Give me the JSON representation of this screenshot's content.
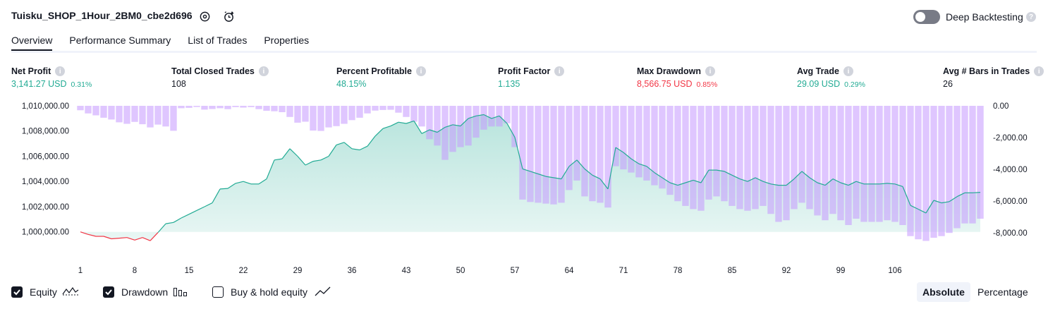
{
  "header": {
    "strategy_title": "Tuisku_SHOP_1Hour_2BM0_cbe2d696",
    "settings_icon": "gear-icon",
    "alert_icon": "alert-clock-icon",
    "deep_backtesting_label": "Deep Backtesting",
    "deep_backtesting_enabled": false
  },
  "tabs": [
    {
      "label": "Overview",
      "active": true
    },
    {
      "label": "Performance Summary",
      "active": false
    },
    {
      "label": "List of Trades",
      "active": false
    },
    {
      "label": "Properties",
      "active": false
    }
  ],
  "stats": [
    {
      "label": "Net Profit",
      "value": "3,141.27 USD",
      "pct": "0.31%",
      "tone": "green"
    },
    {
      "label": "Total Closed Trades",
      "value": "108",
      "pct": "",
      "tone": "dark"
    },
    {
      "label": "Percent Profitable",
      "value": "48.15%",
      "pct": "",
      "tone": "green"
    },
    {
      "label": "Profit Factor",
      "value": "1.135",
      "pct": "",
      "tone": "green"
    },
    {
      "label": "Max Drawdown",
      "value": "8,566.75 USD",
      "pct": "0.85%",
      "tone": "red"
    },
    {
      "label": "Avg Trade",
      "value": "29.09 USD",
      "pct": "0.29%",
      "tone": "green"
    },
    {
      "label": "Avg # Bars in Trades",
      "value": "26",
      "pct": "",
      "tone": "dark"
    }
  ],
  "chart_data": {
    "type": "area",
    "title": "",
    "x_ticks": [
      "1",
      "8",
      "15",
      "22",
      "29",
      "36",
      "43",
      "50",
      "57",
      "64",
      "71",
      "78",
      "85",
      "92",
      "99",
      "106"
    ],
    "left_axis": {
      "ticks": [
        "1,010,000.00",
        "1,008,000.00",
        "1,006,000.00",
        "1,004,000.00",
        "1,002,000.00",
        "1,000,000.00"
      ],
      "ylim": [
        999200,
        1010000
      ]
    },
    "right_axis": {
      "ticks": [
        "0.00",
        "-2,000.00",
        "-4,000.00",
        "-6,000.00",
        "-8,000.00"
      ],
      "ylim": [
        -8566.75,
        0
      ]
    },
    "baseline": 1000000,
    "series": [
      {
        "name": "Equity",
        "type": "area",
        "axis": "left",
        "values": [
          1000000,
          999800,
          999650,
          999650,
          999450,
          999500,
          999550,
          999350,
          999550,
          999300,
          999950,
          1000650,
          1000750,
          1001100,
          1001400,
          1001700,
          1002000,
          1002300,
          1003400,
          1003450,
          1003850,
          1004000,
          1003800,
          1003800,
          1004200,
          1005700,
          1005800,
          1006600,
          1006000,
          1005300,
          1005600,
          1005700,
          1006000,
          1006900,
          1007100,
          1006600,
          1006500,
          1006800,
          1007600,
          1008200,
          1008400,
          1008700,
          1008600,
          1008800,
          1007800,
          1008100,
          1007900,
          1008300,
          1008500,
          1008400,
          1009000,
          1009200,
          1009300,
          1009000,
          1009200,
          1008600,
          1007500,
          1005000,
          1004800,
          1004600,
          1004400,
          1004300,
          1004200,
          1005200,
          1005700,
          1005000,
          1004500,
          1004200,
          1003400,
          1006700,
          1006300,
          1005800,
          1005400,
          1005200,
          1004700,
          1004300,
          1003900,
          1003700,
          1003900,
          1004100,
          1003900,
          1004900,
          1004900,
          1004800,
          1004500,
          1004200,
          1004000,
          1004300,
          1004000,
          1003800,
          1003700,
          1003700,
          1004200,
          1004800,
          1004300,
          1003900,
          1003700,
          1004200,
          1003900,
          1003700,
          1004000,
          1003800,
          1003800,
          1003800,
          1003850,
          1003800,
          1003600,
          1002100,
          1001800,
          1001500,
          1002500,
          1002300,
          1002400,
          1002800,
          1003100,
          1003100,
          1003140
        ]
      },
      {
        "name": "Drawdown",
        "type": "bar",
        "axis": "right",
        "values": [
          -280,
          -480,
          -600,
          -750,
          -860,
          -1040,
          -1130,
          -1010,
          -1160,
          -1360,
          -1180,
          -1300,
          -1570,
          -150,
          -130,
          -70,
          -240,
          -200,
          -150,
          -210,
          -80,
          -110,
          -80,
          -210,
          -310,
          -340,
          -400,
          -700,
          -1060,
          -1000,
          -1560,
          -1580,
          -1360,
          -1280,
          -1130,
          -900,
          -750,
          -480,
          -300,
          -260,
          -250,
          -430,
          -700,
          -1000,
          -1300,
          -2100,
          -2500,
          -3400,
          -2900,
          -2600,
          -2500,
          -2000,
          -1500,
          -1300,
          -1300,
          -1100,
          -2600,
          -5900,
          -6050,
          -6100,
          -6150,
          -6200,
          -6100,
          -5300,
          -4700,
          -5700,
          -6000,
          -6100,
          -6400,
          -3800,
          -4000,
          -4200,
          -4500,
          -4700,
          -5000,
          -5200,
          -5600,
          -6000,
          -6300,
          -6500,
          -6600,
          -5900,
          -5700,
          -6000,
          -6300,
          -6500,
          -6600,
          -6500,
          -6300,
          -6800,
          -7300,
          -7200,
          -6500,
          -6100,
          -6500,
          -6900,
          -7200,
          -6800,
          -7200,
          -7500,
          -7100,
          -7300,
          -7300,
          -7300,
          -7200,
          -7300,
          -7500,
          -8200,
          -8400,
          -8500,
          -8300,
          -8200,
          -8000,
          -7700,
          -7400,
          -7400,
          -7100
        ]
      }
    ],
    "colors": {
      "equity_line": "#22ab94",
      "equity_fill": "#22ab94",
      "loss_line": "#f23645",
      "loss_fill": "#f23645",
      "drawdown": "#c497ff"
    }
  },
  "legend": [
    {
      "label": "Equity",
      "checked": true,
      "icon": "equity-wave-icon"
    },
    {
      "label": "Drawdown",
      "checked": true,
      "icon": "drawdown-bars-icon"
    },
    {
      "label": "Buy & hold equity",
      "checked": false,
      "icon": "buy-hold-line-icon"
    }
  ],
  "view_modes": [
    {
      "label": "Absolute",
      "active": true
    },
    {
      "label": "Percentage",
      "active": false
    }
  ]
}
